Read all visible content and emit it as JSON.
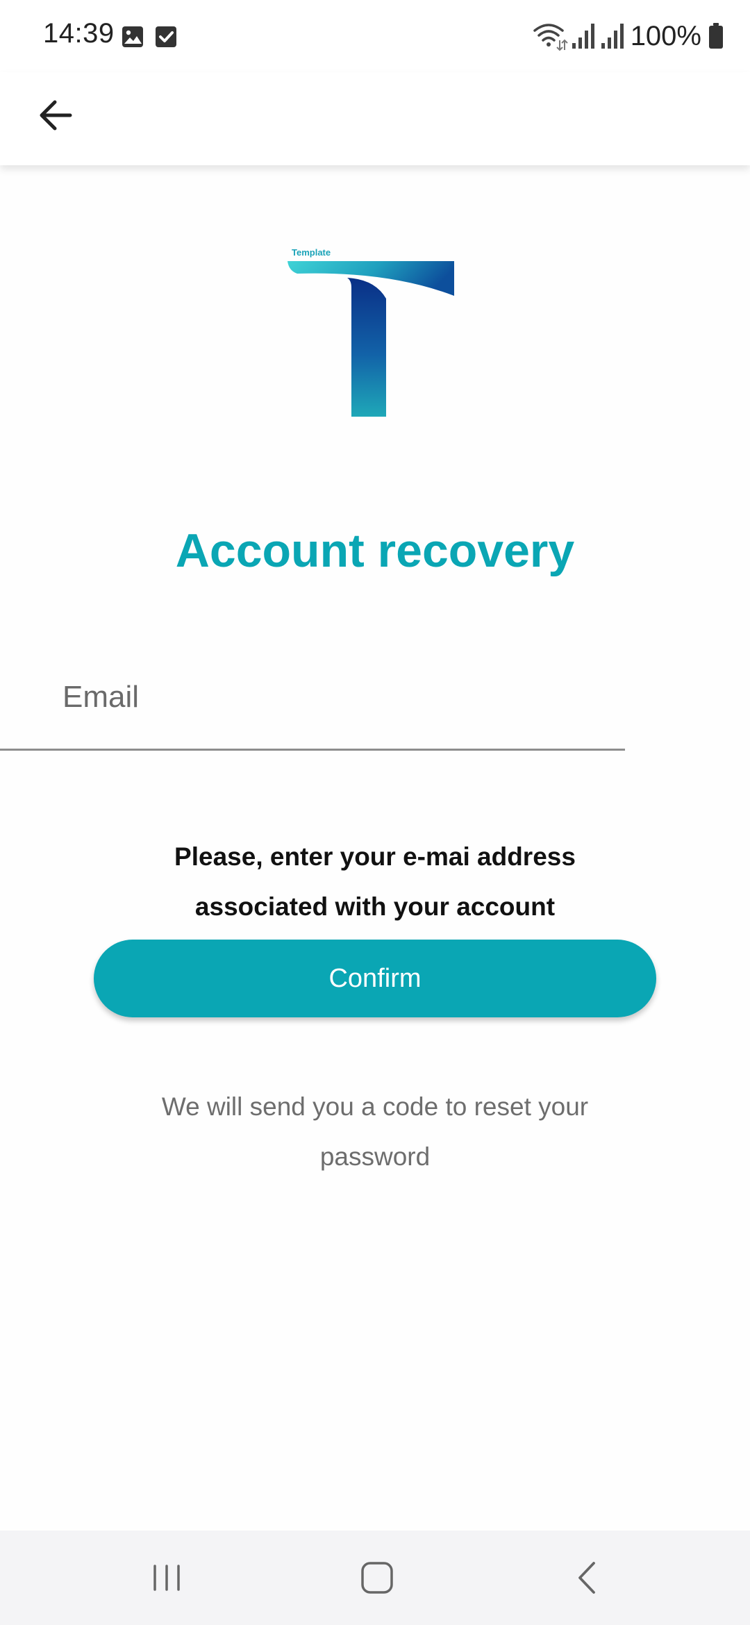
{
  "status_bar": {
    "time": "14:39",
    "battery": "100%",
    "icons": [
      "gallery-notification-icon",
      "checkbox-notification-icon",
      "wifi-icon",
      "signal-icon",
      "signal-icon-2",
      "battery-icon"
    ]
  },
  "app_bar": {
    "back_icon": "arrow-left-icon"
  },
  "logo": {
    "wordmark": "Template",
    "colors": {
      "teal_light": "#39d0d6",
      "blue_dark": "#0a3a8c",
      "teal": "#1aa3b8"
    }
  },
  "recovery": {
    "title": "Account recovery",
    "email_placeholder": "Email",
    "email_value": "",
    "instructions_line1": "Please, enter your e-mai address",
    "instructions_line2": "associated with your account",
    "confirm_label": "Confirm",
    "info_line1": "We will send you a code to reset your",
    "info_line2": "password"
  },
  "nav_bar": {
    "recents_icon": "recents-icon",
    "home_icon": "home-icon",
    "back_icon": "back-chevron-icon"
  },
  "colors": {
    "accent": "#0aa6b4",
    "text_dark": "#111111",
    "text_muted": "#6d6d6d"
  }
}
